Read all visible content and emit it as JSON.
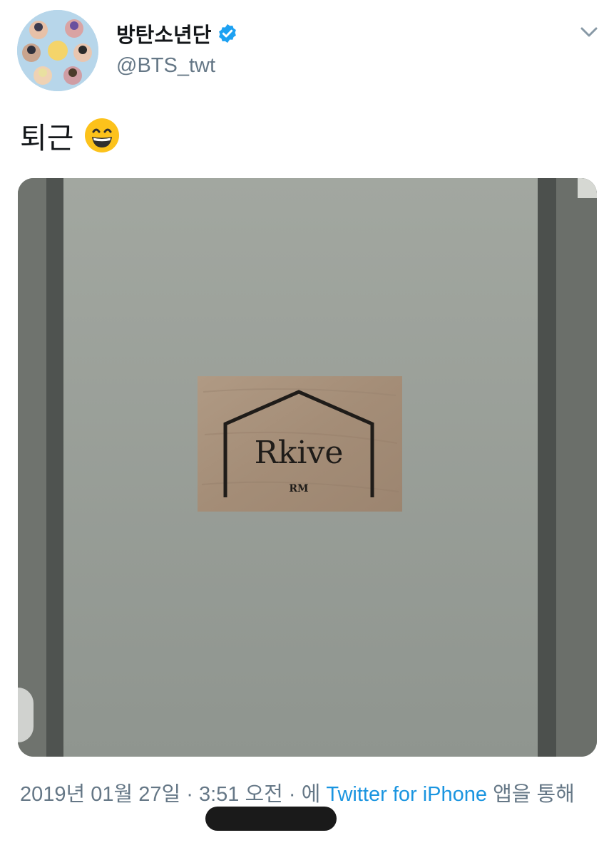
{
  "profile": {
    "display_name": "방탄소년단",
    "handle": "@BTS_twt",
    "verified": true
  },
  "tweet": {
    "text": "퇴근",
    "emoji": "grinning-face-with-smiling-eyes-icon"
  },
  "media": {
    "sign_title": "Rkive",
    "sign_subtitle": "RM"
  },
  "meta": {
    "date": "2019년 01월 27일",
    "separator": " · ",
    "time": "3:51 오전",
    "via_prefix": " · 에 ",
    "source": "Twitter for iPhone",
    "via_suffix": " 앱을 통해"
  },
  "colors": {
    "link": "#1b95e0",
    "secondary_text": "#657786",
    "primary_text": "#14171a",
    "verified": "#1da1f2"
  },
  "icons": {
    "menu": "chevron-down-icon",
    "verified": "verified-badge-icon"
  }
}
